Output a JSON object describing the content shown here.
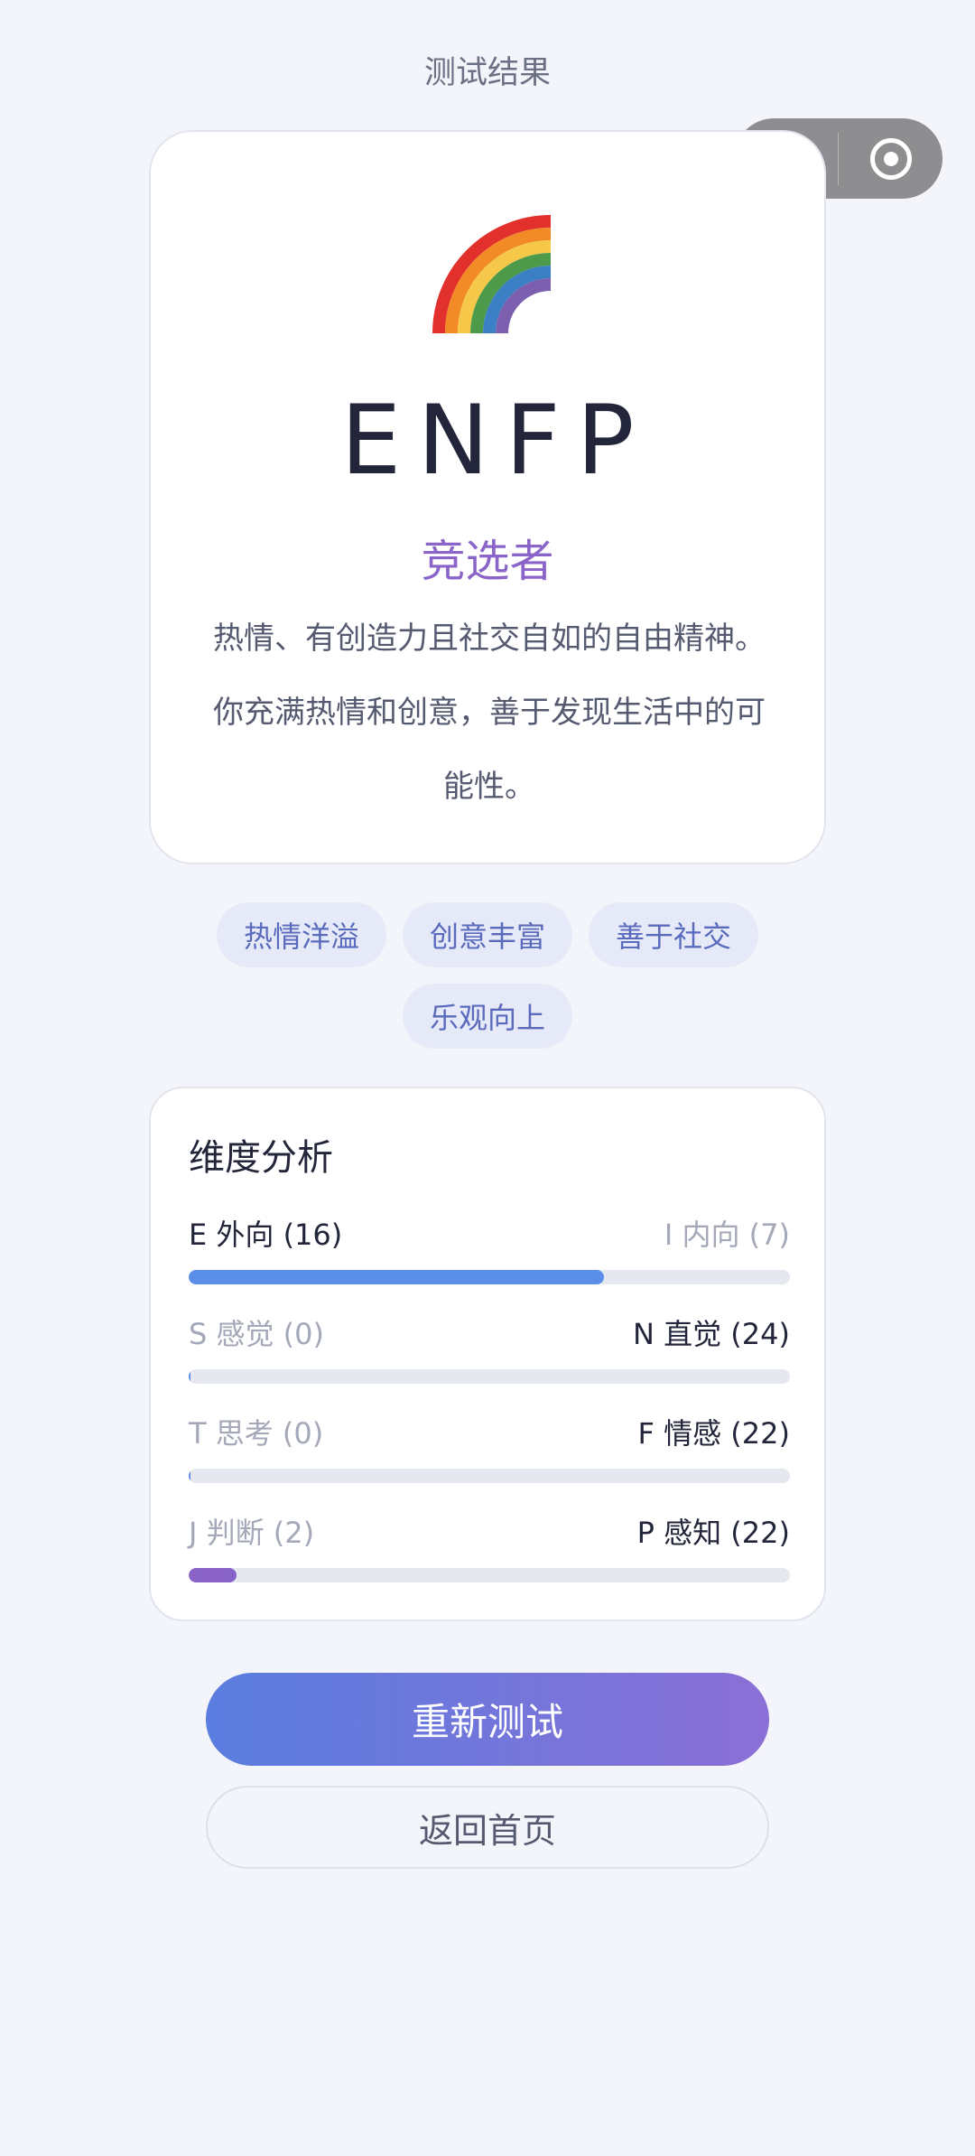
{
  "header": {
    "title": "测试结果"
  },
  "capsule": {
    "more_icon": "more-dots-icon",
    "close_icon": "target-circle-icon"
  },
  "result": {
    "emoji_icon": "rainbow-icon",
    "type_code": "ENFP",
    "type_name": "竞选者",
    "description": "热情、有创造力且社交自如的自由精神。你充满热情和创意，善于发现生活中的可能性。"
  },
  "tags": [
    "热情洋溢",
    "创意丰富",
    "善于社交",
    "乐观向上"
  ],
  "dimensions": {
    "title": "维度分析",
    "items": [
      {
        "left": "E 外向 (16)",
        "right": "I 内向 (7)",
        "dominant": "left",
        "fill_side": "left",
        "fill_fraction": 0.69,
        "color": "#5b8ee8"
      },
      {
        "left": "S 感觉 (0)",
        "right": "N 直觉 (24)",
        "dominant": "right",
        "fill_side": "left",
        "fill_fraction": 0.0,
        "color": "#5b8ee8"
      },
      {
        "left": "T 思考 (0)",
        "right": "F 情感 (22)",
        "dominant": "right",
        "fill_side": "left",
        "fill_fraction": 0.0,
        "color": "#5b8ee8"
      },
      {
        "left": "J 判断 (2)",
        "right": "P 感知 (22)",
        "dominant": "right",
        "fill_side": "left",
        "fill_fraction": 0.08,
        "color": "#8a64c8"
      }
    ]
  },
  "actions": {
    "retest_label": "重新测试",
    "home_label": "返回首页"
  }
}
